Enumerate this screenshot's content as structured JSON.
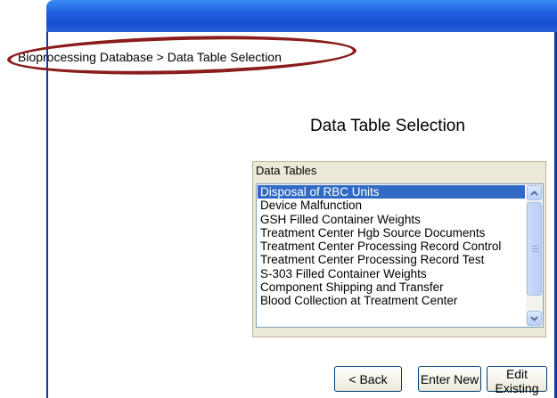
{
  "breadcrumb": "Bioprocessing Database > Data Table Selection",
  "page_title": "Data Table Selection",
  "data_tables": {
    "label": "Data Tables",
    "items": [
      "Disposal of RBC Units",
      "Device Malfunction",
      "GSH Filled Container Weights",
      "Treatment Center Hgb Source Documents",
      "Treatment Center Processing Record Control",
      "Treatment Center Processing Record Test",
      "S-303 Filled Container Weights",
      "Component Shipping and Transfer",
      "Blood Collection at Treatment Center"
    ],
    "selected": "Disposal of RBC Units"
  },
  "buttons": {
    "back": "< Back",
    "enter_new": "Enter New",
    "edit_existing": "Edit Existing"
  },
  "colors": {
    "titlebar": "#1f5fe0",
    "selection": "#316ac5",
    "highlight_ellipse": "#8a1c1c",
    "panel": "#ece9d8"
  },
  "icons": {
    "scroll_up": "chevron-up-icon",
    "scroll_down": "chevron-down-icon"
  }
}
